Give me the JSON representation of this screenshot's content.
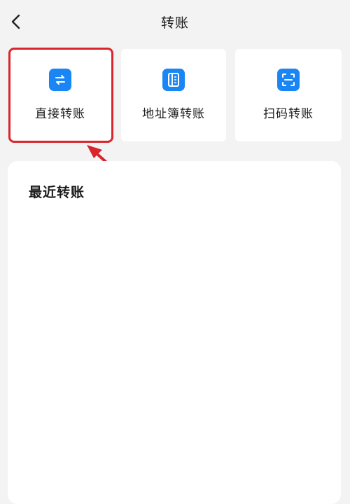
{
  "header": {
    "title": "转账",
    "back_icon": "chevron-left-icon"
  },
  "actions": [
    {
      "label": "直接转账",
      "icon": "swap-arrows-icon",
      "highlighted": true
    },
    {
      "label": "地址簿转账",
      "icon": "address-book-icon",
      "highlighted": false
    },
    {
      "label": "扫码转账",
      "icon": "scan-icon",
      "highlighted": false
    }
  ],
  "recent": {
    "title": "最近转账"
  },
  "colors": {
    "accent": "#1a86f5",
    "highlight": "#d9252b",
    "background": "#f3f3f4"
  }
}
